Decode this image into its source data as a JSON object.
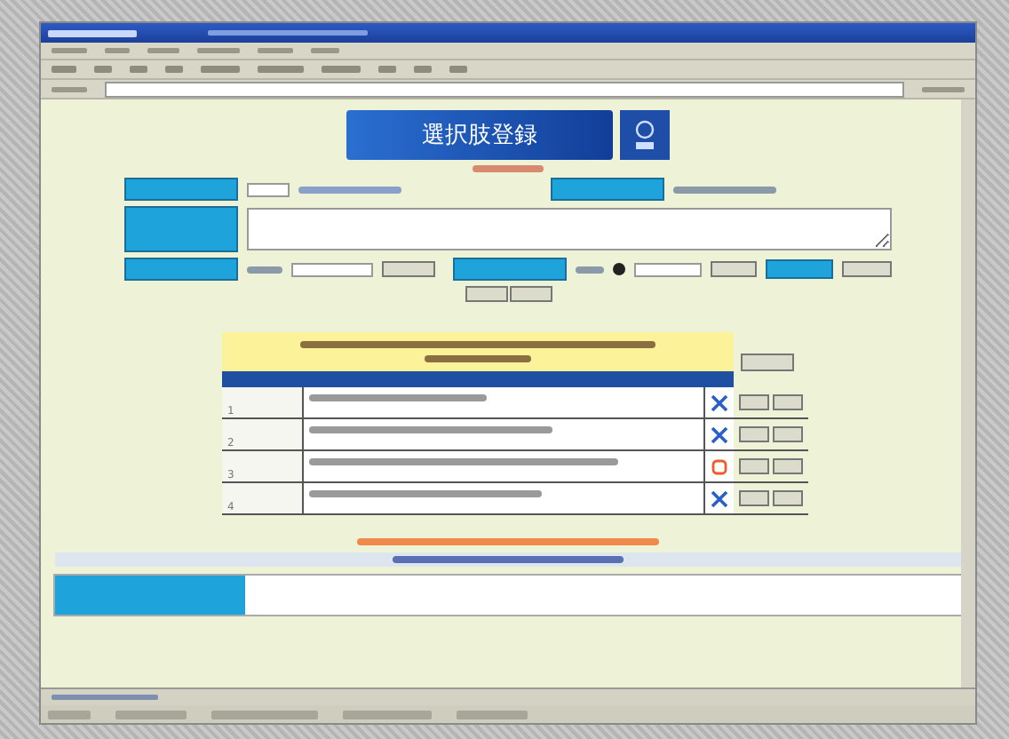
{
  "banner": {
    "title": "選択肢登録"
  },
  "table": {
    "rows": [
      {
        "number": "1",
        "correct": false
      },
      {
        "number": "2",
        "correct": false
      },
      {
        "number": "3",
        "correct": true
      },
      {
        "number": "4",
        "correct": false
      }
    ]
  },
  "progress": {
    "level": 0.21
  }
}
